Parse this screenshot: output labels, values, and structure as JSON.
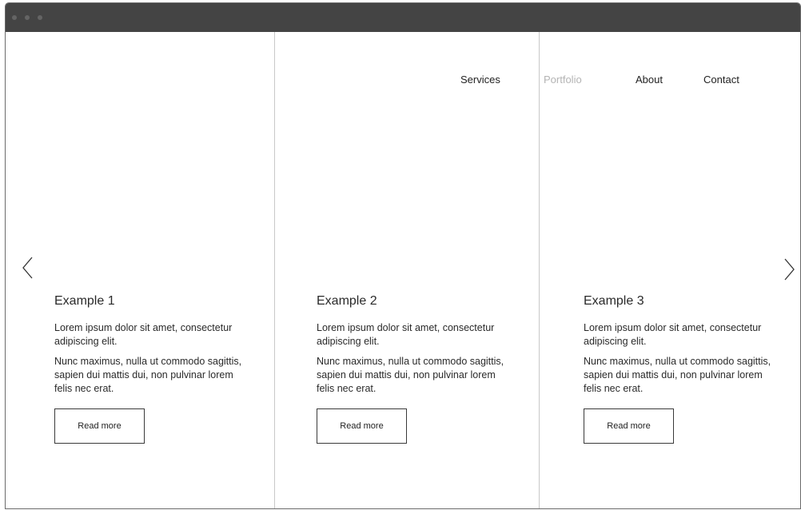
{
  "window": {
    "controls": [
      "window-dot",
      "window-dot",
      "window-dot"
    ]
  },
  "nav": {
    "items": [
      {
        "label": "Services",
        "active": false
      },
      {
        "label": "Portfolio",
        "active": true
      },
      {
        "label": "About",
        "active": false
      },
      {
        "label": "Contact",
        "active": false
      }
    ]
  },
  "carousel": {
    "prev_icon": "chevron-left-icon",
    "next_icon": "chevron-right-icon"
  },
  "cards": [
    {
      "title": "Example 1",
      "paragraph1": "Lorem ipsum dolor sit amet, consectetur adipiscing elit.",
      "paragraph2": "Nunc maximus, nulla ut commodo sagittis, sapien dui mattis dui, non pulvinar lorem felis nec erat.",
      "button": "Read more"
    },
    {
      "title": "Example 2",
      "paragraph1": "Lorem ipsum dolor sit amet, consectetur adipiscing elit.",
      "paragraph2": "Nunc maximus, nulla ut commodo sagittis, sapien dui mattis dui, non pulvinar lorem felis nec erat.",
      "button": "Read more"
    },
    {
      "title": "Example 3",
      "paragraph1": "Lorem ipsum dolor sit amet, consectetur adipiscing elit.",
      "paragraph2": "Nunc maximus, nulla ut commodo sagittis, sapien dui mattis dui, non pulvinar lorem felis nec erat.",
      "button": "Read more"
    }
  ],
  "colors": {
    "titlebar": "#444444",
    "nav_active": "#b4b4b4",
    "text": "#222222"
  }
}
